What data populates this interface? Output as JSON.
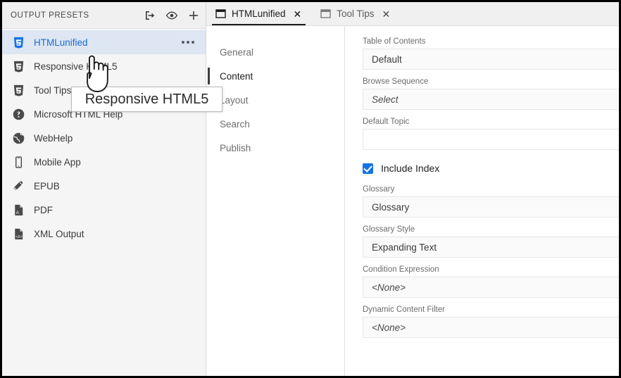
{
  "left_panel": {
    "header_title": "OUTPUT PRESETS",
    "header_icons": [
      {
        "name": "generate-output-icon",
        "label": "Generate Output"
      },
      {
        "name": "preview-eye-icon",
        "label": "Preview"
      },
      {
        "name": "add-plus-icon",
        "label": "Add"
      }
    ],
    "presets": [
      {
        "label": "HTMLunified",
        "icon": "html5-icon",
        "selected": true,
        "icon_color": "#1473e6"
      },
      {
        "label": "Responsive HTML5",
        "icon": "html5-icon",
        "selected": false,
        "icon_color": "#4a4a4a"
      },
      {
        "label": "Tool Tips",
        "icon": "html5-icon",
        "selected": false,
        "icon_color": "#4a4a4a"
      },
      {
        "label": "Microsoft HTML Help",
        "icon": "help-question-icon",
        "selected": false,
        "icon_color": "#4a4a4a"
      },
      {
        "label": "WebHelp",
        "icon": "globe-icon",
        "selected": false,
        "icon_color": "#4a4a4a"
      },
      {
        "label": "Mobile App",
        "icon": "mobile-phone-icon",
        "selected": false,
        "icon_color": "#4a4a4a"
      },
      {
        "label": "EPUB",
        "icon": "epub-book-icon",
        "selected": false,
        "icon_color": "#4a4a4a"
      },
      {
        "label": "PDF",
        "icon": "pdf-file-icon",
        "selected": false,
        "icon_color": "#4a4a4a"
      },
      {
        "label": "XML Output",
        "icon": "xml-file-icon",
        "selected": false,
        "icon_color": "#4a4a4a"
      }
    ],
    "row_menu_label": "..."
  },
  "tabs": [
    {
      "label": "HTMLunified",
      "close": "✕",
      "active": true
    },
    {
      "label": "Tool Tips",
      "close": "✕",
      "active": false
    }
  ],
  "section_nav": {
    "items": [
      {
        "label": "General",
        "active": false
      },
      {
        "label": "Content",
        "active": true
      },
      {
        "label": "Layout",
        "active": false
      },
      {
        "label": "Search",
        "active": false
      },
      {
        "label": "Publish",
        "active": false
      }
    ]
  },
  "form": {
    "fields": [
      {
        "label": "Table of Contents",
        "value": "Default",
        "style": "value"
      },
      {
        "label": "Browse Sequence",
        "value": "Select",
        "style": "placeholder"
      },
      {
        "label": "Default Topic",
        "value": "",
        "style": "empty"
      }
    ],
    "checkbox": {
      "label": "Include Index",
      "checked": true
    },
    "fields_after": [
      {
        "label": "Glossary",
        "value": "Glossary",
        "style": "value"
      },
      {
        "label": "Glossary Style",
        "value": "Expanding Text",
        "style": "value"
      },
      {
        "label": "Condition Expression",
        "value": "<None>",
        "style": "placeholder"
      },
      {
        "label": "Dynamic Content Filter",
        "value": "<None>",
        "style": "placeholder"
      }
    ]
  },
  "tooltip": {
    "text": "Responsive HTML5"
  },
  "colors": {
    "accent_blue": "#1473e6",
    "selection_blue": "#dde6f2",
    "panel_bg": "#f5f5f5",
    "header_bg": "#f0f0f0",
    "field_bg": "#fafafa",
    "text_dark": "#1c1c1c",
    "text_muted": "#6c6c6c"
  }
}
